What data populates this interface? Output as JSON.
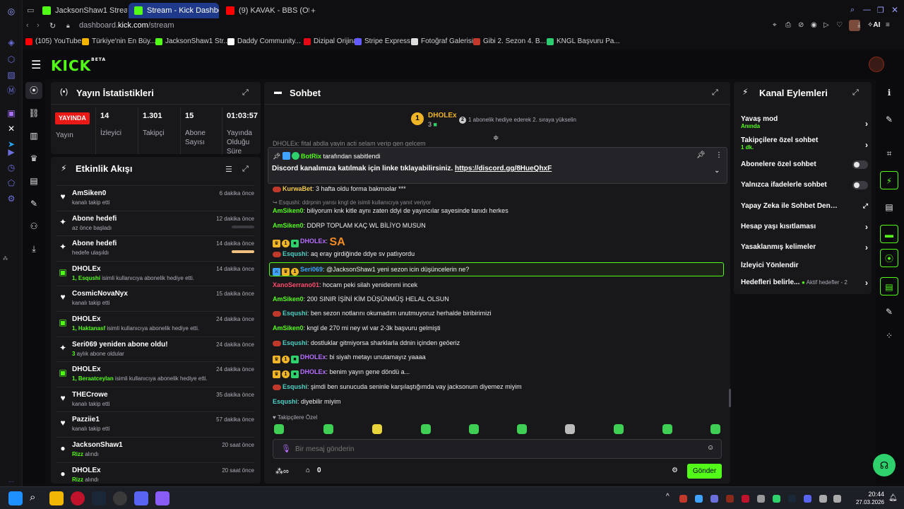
{
  "browser": {
    "tabs": [
      {
        "label": "JacksonShaw1 Stream - W",
        "favicon_color": "#53fc18",
        "active": false
      },
      {
        "label": "Stream - Kick Dashboard",
        "favicon_color": "#53fc18",
        "active": true
      },
      {
        "label": "(9) KAVAK - BBS (Offic",
        "favicon_color": "#ff0000",
        "active": false
      }
    ],
    "new_tab_label": "+",
    "url_prefix": "dashboard.",
    "url_domain": "kick.com",
    "url_path": "/stream",
    "bookmarks": [
      {
        "label": "(105) YouTube",
        "color": "#ff0000"
      },
      {
        "label": "Türkiye'nin En Büy...",
        "color": "#f5b400"
      },
      {
        "label": "JacksonShaw1 Str...",
        "color": "#53fc18"
      },
      {
        "label": "Daddy Community...",
        "color": "#ffffff"
      },
      {
        "label": "Dizipal Orijinal",
        "color": "#e50914"
      },
      {
        "label": "Stripe Express",
        "color": "#635bff"
      },
      {
        "label": "Fotoğraf Galerisi",
        "color": "#dddddd"
      },
      {
        "label": "Gibi 2. Sezon 4. B...",
        "color": "#c0392b"
      },
      {
        "label": "KNGL Başvuru Pa...",
        "color": "#2ecc71"
      }
    ],
    "ai_label": "AI"
  },
  "kick": {
    "logo": "KICK",
    "logo_sup": "BETA"
  },
  "stats": {
    "title": "Yayın İstatistikleri",
    "live_badge": "YAYINDA",
    "status_label": "Yayın",
    "cells": [
      {
        "value": "14",
        "label": "İzleyici"
      },
      {
        "value": "1.301",
        "label": "Takipçi"
      },
      {
        "value": "15",
        "label": "Abone Sayısı"
      },
      {
        "value": "01:03:57",
        "label": "Yayında Olduğu Süre"
      }
    ]
  },
  "activity": {
    "title": "Etkinlik Akışı",
    "items": [
      {
        "icon": "heart-icon",
        "glyph": "♥",
        "name": "AmSiken0",
        "sub_pre": "",
        "sub_hl": "",
        "sub": "kanalı takip etti",
        "time": "6 dakika önce",
        "bar": null
      },
      {
        "icon": "sparkle-icon",
        "glyph": "✦",
        "name": "Abone hedefi",
        "sub_pre": "",
        "sub_hl": "",
        "sub": "az önce başladı",
        "time": "12 dakika önce",
        "bar": 0.0
      },
      {
        "icon": "sparkle-icon",
        "glyph": "✦",
        "name": "Abone hedefi",
        "sub_pre": "",
        "sub_hl": "",
        "sub": "hedefe ulaşıldı",
        "time": "14 dakika önce",
        "bar": 1.0
      },
      {
        "icon": "gift-icon",
        "glyph": "▣",
        "name": "DHOLEx",
        "sub_pre": "",
        "sub_hl": "1, Esqushi",
        "sub": " isimli kullanıcıya abonelik hediye etti.",
        "time": "14 dakika önce",
        "bar": null
      },
      {
        "icon": "heart-icon",
        "glyph": "♥",
        "name": "CosmicNovaNyx",
        "sub_pre": "",
        "sub_hl": "",
        "sub": "kanalı takip etti",
        "time": "15 dakika önce",
        "bar": null
      },
      {
        "icon": "gift-icon",
        "glyph": "▣",
        "name": "DHOLEx",
        "sub_pre": "",
        "sub_hl": "1, Haktanasf",
        "sub": " isimli kullanıcıya abonelik hediye etti.",
        "time": "24 dakika önce",
        "bar": null
      },
      {
        "icon": "sparkle-icon",
        "glyph": "✦",
        "name": "Seri069 yeniden abone oldu!",
        "sub_pre": "",
        "sub_hl": "3",
        "sub": " aylık abone oldular",
        "time": "24 dakika önce",
        "bar": null
      },
      {
        "icon": "gift-icon",
        "glyph": "▣",
        "name": "DHOLEx",
        "sub_pre": "",
        "sub_hl": "1, Beraatceylan",
        "sub": " isimli kullanıcıya abonelik hediye etti.",
        "time": "24 dakika önce",
        "bar": null
      },
      {
        "icon": "heart-icon",
        "glyph": "♥",
        "name": "THECrowe",
        "sub_pre": "",
        "sub_hl": "",
        "sub": "kanalı takip etti",
        "time": "35 dakika önce",
        "bar": null
      },
      {
        "icon": "heart-icon",
        "glyph": "♥",
        "name": "Pazziie1",
        "sub_pre": "",
        "sub_hl": "",
        "sub": "kanalı takip etti",
        "time": "57 dakika önce",
        "bar": null
      },
      {
        "icon": "bubbles-icon",
        "glyph": "●",
        "name": "JacksonShaw1",
        "sub_pre": "",
        "sub_hl": "Rizz",
        "sub": " alındı",
        "time": "20 saat önce",
        "bar": null
      },
      {
        "icon": "bubbles-icon",
        "glyph": "●",
        "name": "DHOLEx",
        "sub_pre": "",
        "sub_hl": "Rizz",
        "sub": " alındı",
        "time": "20 saat önce",
        "bar": null
      }
    ]
  },
  "chat": {
    "title": "Sohbet",
    "top_gifter": {
      "rank": "1",
      "name": "DHOLEx",
      "count": "3",
      "note_num": "2",
      "note": "1 abonelik hediye ederek 2. sıraya yükselin"
    },
    "pinned": {
      "by": "BotRix",
      "by_suffix": " tarafından sabitlendi",
      "text": "Discord kanalımıza katılmak için linke tıklayabilirsiniz. ",
      "link": "https://discord.gg/8HueQhxF"
    },
    "cut_line": "DHOLEx: fital abdla yayin acti selam verip gen gelcem",
    "messages": [
      {
        "badges": [
          "tiny"
        ],
        "user": "KurwaBet",
        "color": "#f2c94c",
        "text": "3 hafta oldu forma bakmıolar ***"
      },
      {
        "badges": [],
        "user": "",
        "color": "#8a8a93",
        "text": "↪ Esqushi: ddrpnin yarısı kngl de isimli kullanıcıya yanıt veriyor",
        "reply": true
      },
      {
        "badges": [],
        "user": "AmSiken0",
        "color": "#53fc18",
        "text": "biliyorum knk kitle aynı zaten ddyi de yayıncılar sayesinde tanıdı herkes"
      },
      {
        "badges": [],
        "user": "AmSiken0",
        "color": "#53fc18",
        "text": "DDRP TOPLAM KAÇ WL BİLİYO MUSUN"
      },
      {
        "badges": [
          "crown",
          "sub",
          "gift"
        ],
        "user": "DHOLEx",
        "color": "#b66cff",
        "text": "SA",
        "emote_text": true
      },
      {
        "badges": [
          "tiny"
        ],
        "user": "Esqushi",
        "color": "#4fd1c5",
        "text": "aq eray girdiğinde ddye sv patlıyordu"
      },
      {
        "badges": [
          "mod",
          "crown",
          "sub"
        ],
        "user": "Seri069",
        "color": "#3fa3ff",
        "text": "@JacksonShaw1 yeni sezon icin düşüncelerin ne?",
        "highlight": true
      },
      {
        "badges": [],
        "user": "XanoSerrano01",
        "color": "#ff4d6d",
        "text": "hocam peki silah yenidenmi incek"
      },
      {
        "badges": [],
        "user": "AmSiken0",
        "color": "#53fc18",
        "text": "200 SINIR İŞİNİ KİM DÜŞÜNMÜŞ HELAL OLSUN"
      },
      {
        "badges": [
          "tiny"
        ],
        "user": "Esqushi",
        "color": "#4fd1c5",
        "text": "ben sezon notlarını okumadım unutmuyoruz herhalde biribirimizi"
      },
      {
        "badges": [],
        "user": "AmSiken0",
        "color": "#53fc18",
        "text": "kngl de 270 mi ney wl var 2-3k başvuru gelmişti"
      },
      {
        "badges": [
          "tiny"
        ],
        "user": "Esqushi",
        "color": "#4fd1c5",
        "text": "dostluklar gitmiyorsa sharklarla ddnin içinden geöeriz"
      },
      {
        "badges": [
          "crown",
          "sub",
          "gift"
        ],
        "user": "DHOLEx",
        "color": "#b66cff",
        "text": "bi siyah metayı unutamayız yaaaa"
      },
      {
        "badges": [
          "crown",
          "sub",
          "gift"
        ],
        "user": "DHOLEx",
        "color": "#b66cff",
        "text": "benim yayın gene döndü a..."
      },
      {
        "badges": [
          "tiny"
        ],
        "user": "Esqushi",
        "color": "#4fd1c5",
        "text": "şimdi ben sunucuda seninle karşılaştığımda vay jacksonum diyemez miyim"
      },
      {
        "badges": [],
        "user": "Esqushi",
        "color": "#4fd1c5",
        "text": "diyebilir miyim"
      }
    ],
    "followers_only": "Takipçilere Özel",
    "input_placeholder": "Bir mesaj gönderin",
    "points_count": "0",
    "send_label": "Gönder"
  },
  "channel_actions": {
    "title": "Kanal Eylemleri",
    "rows": [
      {
        "label": "Yavaş mod",
        "sub": "Anında",
        "control": "chevron"
      },
      {
        "label": "Takipçilere özel sohbet",
        "sub": "1 dk.",
        "control": "chevron"
      },
      {
        "label": "Abonelere özel sohbet",
        "sub": "",
        "control": "toggle"
      },
      {
        "label": "Yalnızca ifadelerle sohbet",
        "sub": "",
        "control": "toggle"
      },
      {
        "label": "Yapay Zeka ile Sohbet Denetimi",
        "sub": "",
        "control": "external"
      },
      {
        "label": "Hesap yaşı kısıtlaması",
        "sub": "",
        "control": "chevron"
      },
      {
        "label": "Yasaklanmış kelimeler",
        "sub": "",
        "control": "chevron"
      },
      {
        "label": "İzleyici Yönlendir",
        "sub": "",
        "control": "none"
      },
      {
        "label": "Hedefleri belirle...",
        "sub": "",
        "control": "chevron",
        "aside": "Aktif hedefler - 2"
      }
    ]
  },
  "taskbar": {
    "time": "20:44",
    "date": "27.03.2026"
  },
  "colors": {
    "accent": "#53fc18",
    "live": "#e91916",
    "panel": "#18181b"
  }
}
